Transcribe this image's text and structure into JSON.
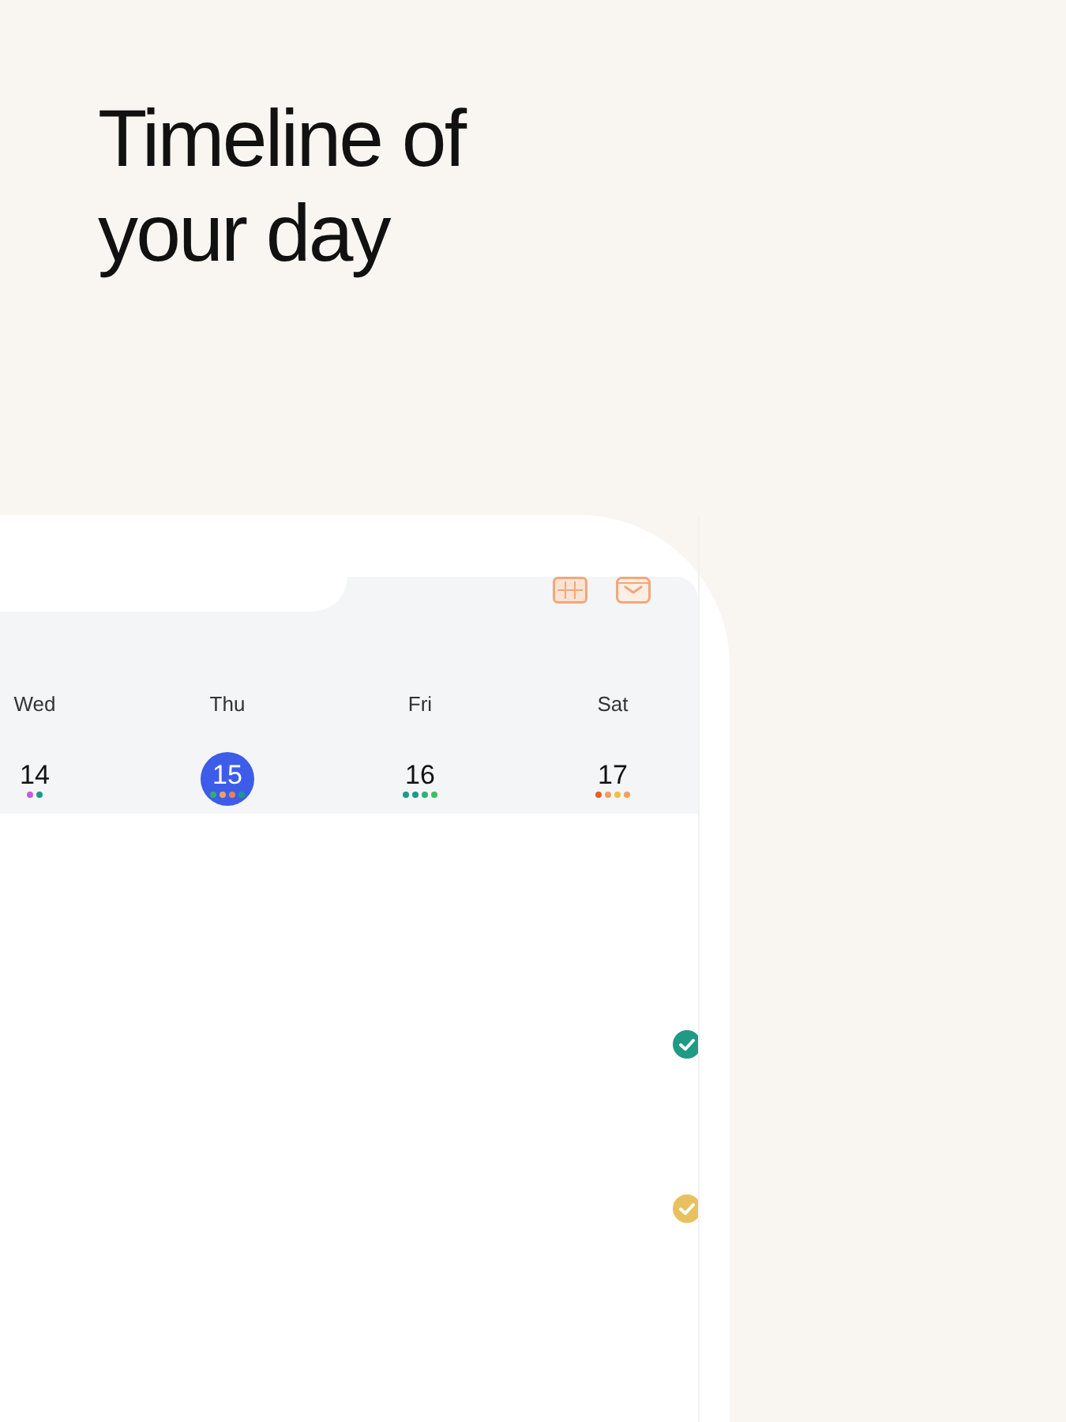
{
  "heading": {
    "title": "Timeline of your day"
  },
  "calendar": {
    "days": [
      {
        "weekday": "Wed",
        "date": "14",
        "selected": false,
        "dots": [
          {
            "color": "#c45be0"
          },
          {
            "color": "#1a9a8a"
          }
        ]
      },
      {
        "weekday": "Thu",
        "date": "15",
        "selected": true,
        "dots": [
          {
            "color": "#2fb06a"
          },
          {
            "color": "#f0a060"
          },
          {
            "color": "#e8805a"
          },
          {
            "color": "#1a9a8a"
          }
        ]
      },
      {
        "weekday": "Fri",
        "date": "16",
        "selected": false,
        "dots": [
          {
            "color": "#1a9a8a"
          },
          {
            "color": "#1a9a8a"
          },
          {
            "color": "#2fb07a"
          },
          {
            "color": "#3cc060"
          }
        ]
      },
      {
        "weekday": "Sat",
        "date": "17",
        "selected": false,
        "dots": [
          {
            "color": "#e0602a"
          },
          {
            "color": "#f0a060"
          },
          {
            "color": "#f0c040"
          },
          {
            "color": "#f0a060"
          }
        ]
      }
    ]
  },
  "tasks": [
    {
      "checked": true,
      "color": "#1f9a84"
    },
    {
      "checked": true,
      "color": "#e8c060"
    }
  ]
}
